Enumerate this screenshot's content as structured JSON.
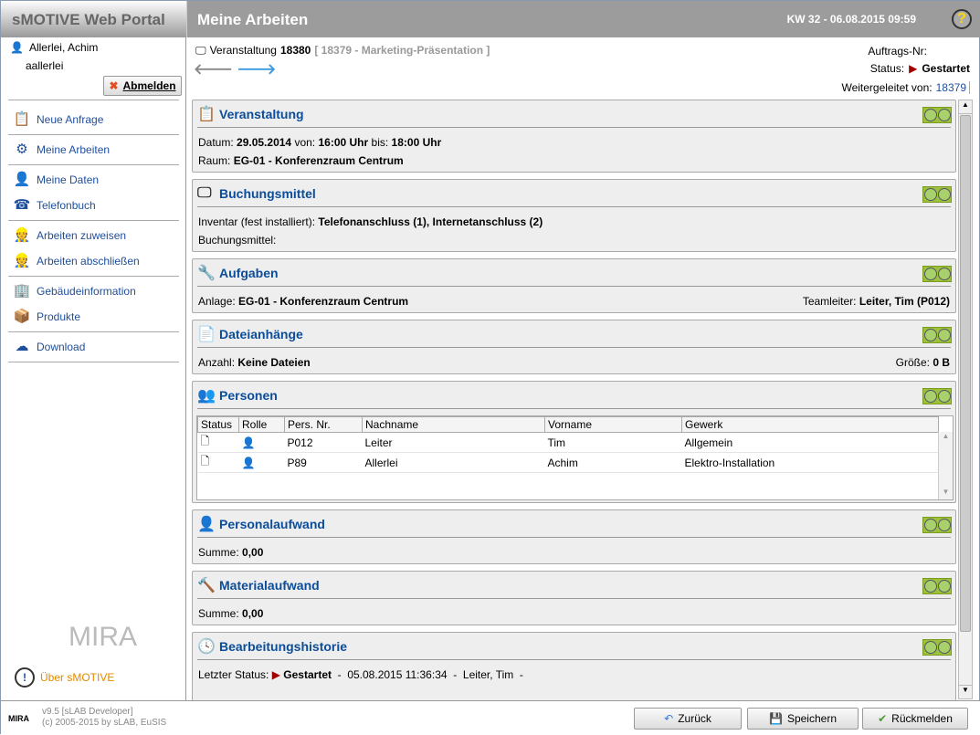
{
  "app": {
    "title": "sMOTIVE Web Portal",
    "page_title": "Meine Arbeiten",
    "datetime": "KW 32 - 06.08.2015 09:59",
    "help": "?"
  },
  "user": {
    "name": "Allerlei, Achim",
    "login": "aallerlei",
    "logout": "Abmelden"
  },
  "sidebar": {
    "items": [
      {
        "label": "Neue Anfrage"
      },
      {
        "label": "Meine Arbeiten"
      },
      {
        "label": "Meine Daten"
      },
      {
        "label": "Telefonbuch"
      },
      {
        "label": "Arbeiten zuweisen"
      },
      {
        "label": "Arbeiten abschließen"
      },
      {
        "label": "Gebäudeinformation"
      },
      {
        "label": "Produkte"
      },
      {
        "label": "Download"
      }
    ],
    "logo": "MIRA",
    "about": "Über sMOTIVE"
  },
  "record": {
    "type": "Veranstaltung",
    "id": "18380",
    "ref": "[ 18379 - Marketing-Präsentation ]",
    "order_label": "Auftrags-Nr:",
    "status_label": "Status:",
    "status": "Gestartet",
    "forwarded_label": "Weitergeleitet von:",
    "forwarded": "18379"
  },
  "sections": {
    "veranstaltung": {
      "title": "Veranstaltung",
      "datum_label": "Datum:",
      "datum": "29.05.2014",
      "von_label": "von:",
      "von": "16:00 Uhr",
      "bis_label": "bis:",
      "bis": "18:00 Uhr",
      "raum_label": "Raum:",
      "raum": "EG-01 - Konferenzraum Centrum"
    },
    "buchungsmittel": {
      "title": "Buchungsmittel",
      "inventar_label": "Inventar (fest installiert):",
      "inventar": "Telefonanschluss (1), Internetanschluss (2)",
      "bm_label": "Buchungsmittel:"
    },
    "aufgaben": {
      "title": "Aufgaben",
      "anlage_label": "Anlage:",
      "anlage": "EG-01 - Konferenzraum Centrum",
      "tl_label": "Teamleiter:",
      "tl": "Leiter, Tim (P012)"
    },
    "dateien": {
      "title": "Dateianhänge",
      "anzahl_label": "Anzahl:",
      "anzahl": "Keine Dateien",
      "groesse_label": "Größe:",
      "groesse": "0 B"
    },
    "personen": {
      "title": "Personen",
      "columns": [
        "Status",
        "Rolle",
        "Pers. Nr.",
        "Nachname",
        "Vorname",
        "Gewerk"
      ],
      "rows": [
        {
          "nr": "P012",
          "nachname": "Leiter",
          "vorname": "Tim",
          "gewerk": "Allgemein"
        },
        {
          "nr": "P89",
          "nachname": "Allerlei",
          "vorname": "Achim",
          "gewerk": "Elektro-Installation"
        }
      ]
    },
    "personal": {
      "title": "Personalaufwand",
      "summe_label": "Summe:",
      "summe": "0,00"
    },
    "material": {
      "title": "Materialaufwand",
      "summe_label": "Summe:",
      "summe": "0,00"
    },
    "historie": {
      "title": "Bearbeitungshistorie",
      "label": "Letzter Status:",
      "status": "Gestartet",
      "dash1": "-",
      "date": "05.08.2015 11:36:34",
      "dash2": "-",
      "user": "Leiter, Tim",
      "dash3": "-"
    }
  },
  "footer": {
    "version": "v9.5 [sLAB Developer]",
    "copyright": "(c) 2005-2015 by sLAB, EuSIS",
    "logo": "MIRA",
    "back": "Zurück",
    "save": "Speichern",
    "report": "Rückmelden"
  },
  "colors": {
    "accent": "#0b4d9a",
    "status": "#a00000",
    "traffic_light": "#9cc13a",
    "about": "#e08a00"
  }
}
